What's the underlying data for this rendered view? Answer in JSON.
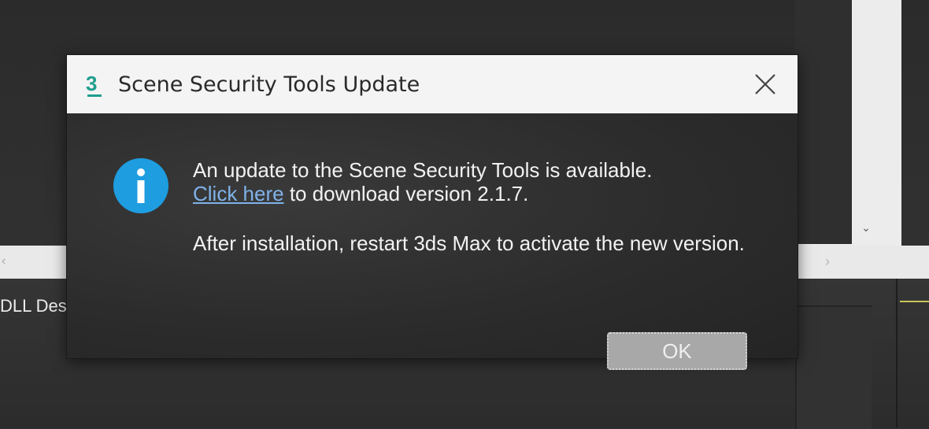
{
  "background": {
    "partial_label": "DLL Des",
    "left_arrow_icon": "chevron-left-icon",
    "right_arrow_icon": "chevron-right-icon",
    "scroll_arrow_icon": "chevron-down-icon"
  },
  "dialog": {
    "app_icon": "3ds-max-icon",
    "title": "Scene Security Tools Update",
    "close_icon": "close-icon",
    "info_icon": "info-icon",
    "message_line1": "An update to the Scene Security Tools is available.",
    "link_text": "Click here",
    "message_line2_rest": " to download version 2.1.7.",
    "message_line3": "After installation, restart 3ds Max to activate the new version.",
    "ok_label": "OK"
  },
  "colors": {
    "info_blue": "#1e9de0",
    "link_blue": "#7fb2ea",
    "app_icon_teal": "#1f9e8e",
    "dialog_body": "#2c2c2c",
    "titlebar": "#f4f4f4"
  }
}
